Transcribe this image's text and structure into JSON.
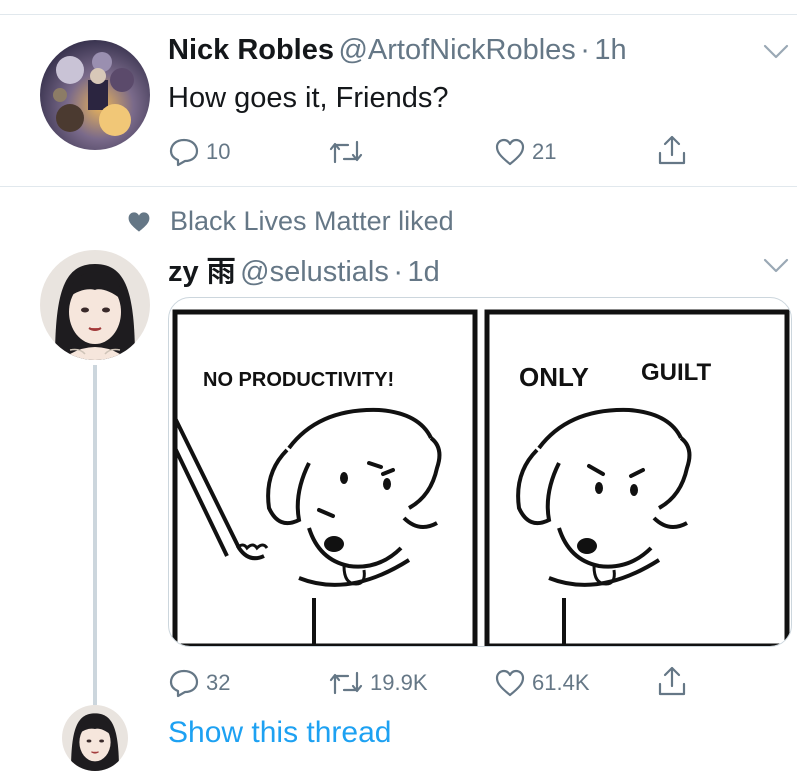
{
  "tweet1": {
    "name": "Nick Robles",
    "handle": "@ArtofNickRobles",
    "dot": "·",
    "time": "1h",
    "text": "How goes it, Friends?",
    "replies": "10",
    "retweets": "",
    "likes": "21"
  },
  "tweet2": {
    "social_context": "Black Lives Matter liked",
    "name": "zy 雨",
    "handle": "@selustials",
    "dot": "·",
    "time": "1d",
    "replies": "32",
    "retweets": "19.9K",
    "likes": "61.4K",
    "media": {
      "panel1_text": "NO PRODUCTIVITY!",
      "panel2_text_a": "ONLY",
      "panel2_text_b": "GUILT"
    }
  },
  "show_thread": "Show this thread",
  "colors": {
    "text": "#14171a",
    "secondary": "#657786",
    "link": "#1da1f2",
    "divider": "#e1e8ed",
    "thread_line": "#ccd6dd"
  },
  "icons": [
    "reply-icon",
    "retweet-icon",
    "like-icon",
    "share-icon",
    "caret-down-icon",
    "heart-filled-icon"
  ]
}
